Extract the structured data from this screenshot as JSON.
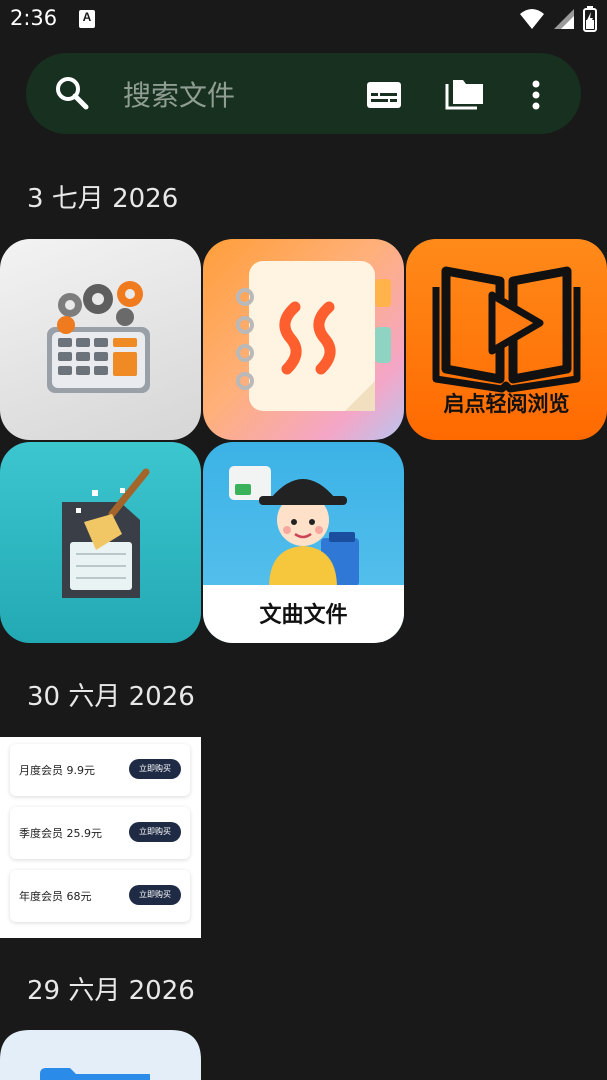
{
  "status_bar": {
    "time": "2:36",
    "notification_icon": "A"
  },
  "search": {
    "placeholder": "搜索文件"
  },
  "sections": [
    {
      "date": "3 七月 2026",
      "items": [
        {
          "name": "calculator-gears-icon"
        },
        {
          "name": "notebook-icon"
        },
        {
          "name": "book-play-icon",
          "label": "启点轻阅浏览"
        },
        {
          "name": "sd-card-cleaner-icon"
        },
        {
          "name": "scholar-file-icon",
          "label": "文曲文件"
        }
      ]
    },
    {
      "date": "30 六月 2026",
      "items": [
        {
          "name": "membership-screenshot",
          "plans": [
            {
              "text": "月度会员  9.9元",
              "button": "立即购买"
            },
            {
              "text": "季度会员  25.9元",
              "button": "立即购买"
            },
            {
              "text": "年度会员  68元",
              "button": "立即购买"
            }
          ]
        }
      ]
    },
    {
      "date": "29 六月 2026",
      "items": [
        {
          "name": "folder-app-icon"
        }
      ]
    }
  ],
  "colors": {
    "background": "#191919",
    "search_bar": "#17301f"
  }
}
